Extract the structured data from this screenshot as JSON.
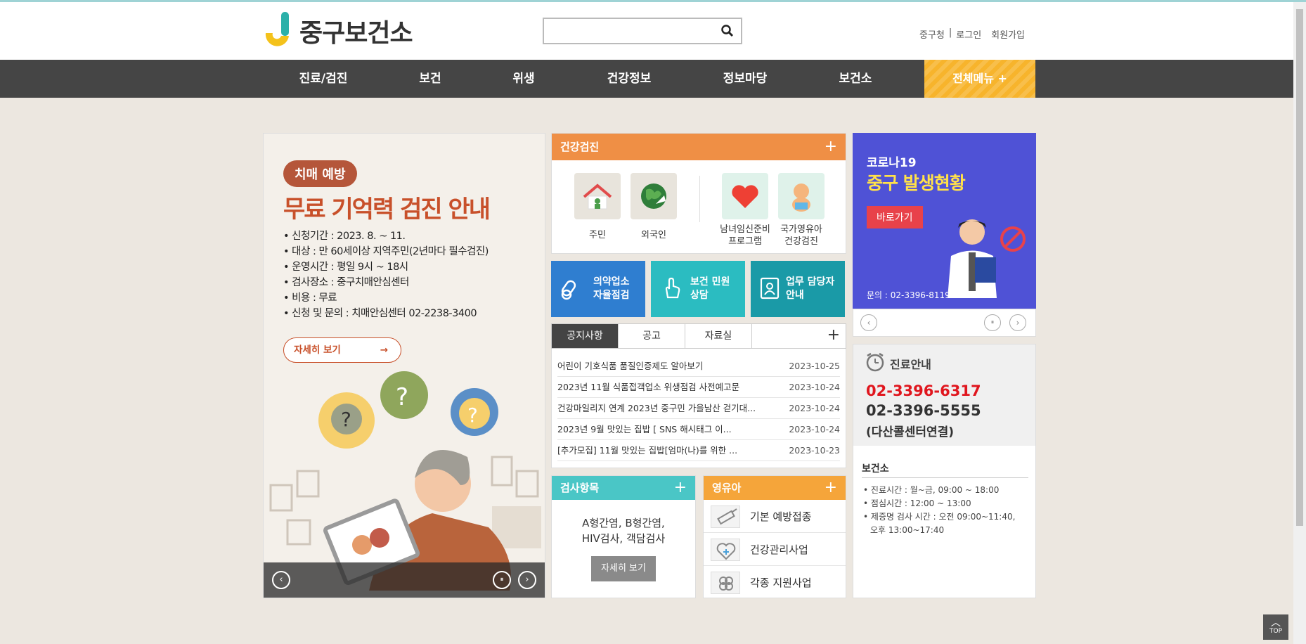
{
  "header": {
    "logo_text": "중구보건소",
    "search_placeholder": "",
    "util": [
      "중구청",
      "|",
      "로그인",
      "회원가입"
    ]
  },
  "nav": {
    "items": [
      "진료/검진",
      "보건",
      "위생",
      "건강정보",
      "정보마당",
      "보건소"
    ],
    "all_menu": "전체메뉴  +"
  },
  "banner": {
    "badge": "치매 예방",
    "title": "무료 기억력 검진 안내",
    "lines": [
      "신청기간 : 2023. 8. ~ 11.",
      "대상 : 만 60세이상 지역주민(2년마다 필수검진)",
      "운영시간 : 평일 9시 ~ 18시",
      "검사장소 : 중구치매안심센터",
      "비용 : 무료",
      "신청 및 문의 : 치매안심센터 02-2238-3400"
    ],
    "more": "자세히 보기",
    "controls": {
      "prev": "‹",
      "pause": "⏸",
      "next": "›"
    }
  },
  "health_check": {
    "title": "건강검진",
    "plus": "+",
    "items": [
      {
        "label": "주민"
      },
      {
        "label": "외국인"
      },
      {
        "label": "남녀임신준비\n프로그램"
      },
      {
        "label": "국가영유아\n건강검진"
      }
    ]
  },
  "quick": [
    {
      "label": "의약업소\n자율점검",
      "color": "#2f7ed0"
    },
    {
      "label": "보건 민원\n상담",
      "color": "#2bbcc1"
    },
    {
      "label": "업무 담당자\n안내",
      "color": "#1a9aa7"
    }
  ],
  "notice": {
    "tabs": [
      "공지사항",
      "공고",
      "자료실"
    ],
    "plus": "+",
    "rows": [
      {
        "title": "어린이 기호식품 품질인증제도 알아보기",
        "date": "2023-10-25"
      },
      {
        "title": "2023년 11월 식품접객업소 위생점검 사전예고문",
        "date": "2023-10-24"
      },
      {
        "title": "건강마일리지 연계 2023년 중구민 가을남산 걷기대...",
        "date": "2023-10-24"
      },
      {
        "title": "2023년 9월 맛있는 집밥 [ SNS 해시태그 이...",
        "date": "2023-10-24"
      },
      {
        "title": "[추가모집] 11월 맛있는 집밥[엄마(나)를 위한 ...",
        "date": "2023-10-23"
      }
    ]
  },
  "inspect": {
    "title": "검사항목",
    "plus": "+",
    "line1": "A형간염, B형간염,",
    "line2": "HIV검사, 객담검사",
    "button": "자세히 보기"
  },
  "infant": {
    "title": "영유아",
    "plus": "+",
    "items": [
      "기본 예방접종",
      "건강관리사업",
      "각종 지원사업"
    ]
  },
  "covid": {
    "line1": "코로나19",
    "line2": "중구 발생현황",
    "button": "바로가기",
    "contact": "문의 : 02-3396-8119",
    "controls": {
      "prev": "‹",
      "pause": "⏸",
      "next": "›"
    }
  },
  "clinic": {
    "title": "진료안내",
    "phone1": "02-3396-6317",
    "phone2": "02-3396-5555",
    "phone_note": "(다산콜센터연결)",
    "section": "보건소",
    "hours": [
      "진료시간 : 월~금, 09:00 ~ 18:00",
      "점심시간 : 12:00 ~ 13:00",
      "제증명 검사 시간 : 오전 09:00~11:40,",
      "오후 13:00~17:40"
    ]
  },
  "top_button": "TOP",
  "colors": {
    "nav_bg": "#454545",
    "all_menu": "#f7b42c",
    "health_hd": "#ef8f45",
    "inspect_hd": "#4ac6c6",
    "infant_hd": "#f5a53a",
    "covid_bg": "#4f52d6",
    "phone_red": "#e0161e"
  }
}
